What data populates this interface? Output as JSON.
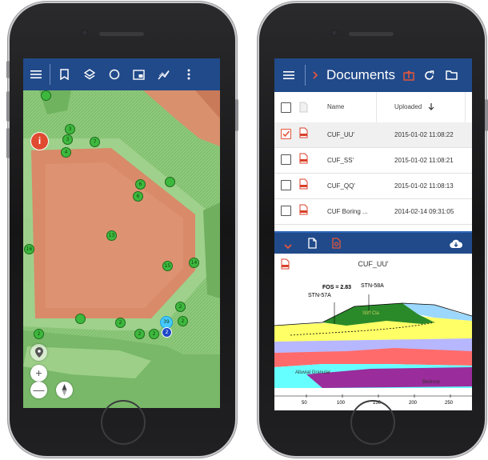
{
  "left_phone": {
    "toolbar": {
      "icons": [
        "menu-icon",
        "bookmark-icon",
        "layers-icon",
        "circle-icon",
        "map-frame-icon",
        "measure-icon",
        "more-vert-icon"
      ]
    },
    "info_button": "i",
    "markers": [
      {
        "label": "3"
      },
      {
        "label": "3"
      },
      {
        "label": "4"
      },
      {
        "label": "4"
      },
      {
        "label": "7"
      },
      {
        "label": "6"
      },
      {
        "label": "6"
      },
      {
        "label": "13"
      },
      {
        "label": "16"
      },
      {
        "label": "15"
      },
      {
        "label": "14"
      },
      {
        "label": "2"
      },
      {
        "label": "2"
      },
      {
        "label": "2"
      },
      {
        "label": "2"
      },
      {
        "label": "2"
      },
      {
        "label": "2"
      },
      {
        "label": "2"
      },
      {
        "label": "2"
      }
    ],
    "selected_marker": "39",
    "blue_marker": "2",
    "zoom_in": "+",
    "zoom_out": "—",
    "colors": {
      "toolbar": "#214a8a",
      "pad": "#d97f62",
      "terrain": "#7cc26a",
      "marker": "#3db83d"
    }
  },
  "right_phone": {
    "header": {
      "title": "Documents"
    },
    "table": {
      "columns": [
        "Name",
        "Uploaded"
      ],
      "rows": [
        {
          "name": "CUF_UU'",
          "uploaded": "2015-01-02 11:08:22",
          "checked": true
        },
        {
          "name": "CUF_SS'",
          "uploaded": "2015-01-02 11:08:21",
          "checked": false
        },
        {
          "name": "CUF_QQ'",
          "uploaded": "2015-01-02 11:08:13",
          "checked": false
        },
        {
          "name": "CUF Boring ...",
          "uploaded": "2014-02-14 09:31:05",
          "checked": false
        }
      ]
    },
    "viewer": {
      "title": "CUF_UU'",
      "fos_label": "FOS = 2.83",
      "stations": [
        "STN-57A",
        "STN-58A"
      ],
      "layer_labels": [
        "Alluvial Granular",
        "Bedrock",
        "Stiff Cla"
      ],
      "x_ticks": [
        "50",
        "100",
        "150",
        "200",
        "250"
      ]
    },
    "colors": {
      "bar": "#214a8a",
      "accent": "#e2563b"
    }
  }
}
